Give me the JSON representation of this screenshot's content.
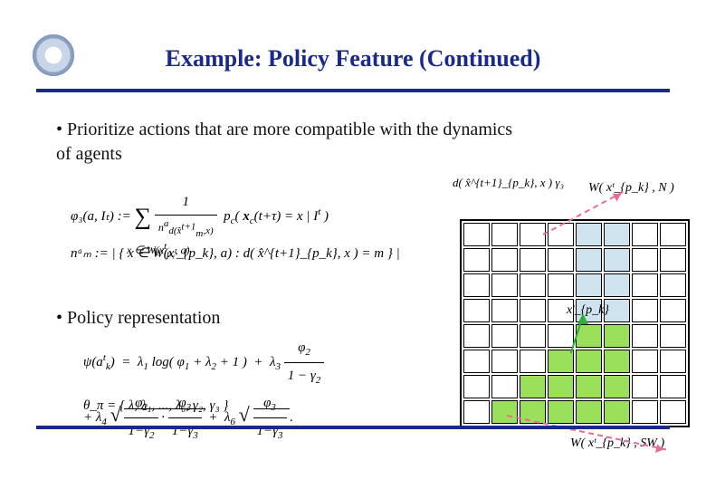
{
  "title": "Example: Policy Feature (Continued)",
  "bullets": {
    "b1": "Prioritize actions that are more compatible with the dynamics of agents",
    "b2": "Policy representation"
  },
  "eq": {
    "phi3": "φ₃(a, Iₜ)  :=",
    "phi3_body": "∑  (1 / nᵃ_{d(x̂ᵐ^{t+1}, x)})  p_c( x_c(t+τ) = x | I^t )",
    "nm": "nᵃₘ :=  | { x ∈ W(xᵗ_{p_k}, a)  :  d( x̂^{t+1}_{p_k}, x ) = m } |",
    "psi": "ψ(aᵗ_k)  =  λ₁ log( φ₁ + λ₂ + 1 )  +  λ₃  φ₂ / (1 − γ₂)",
    "psi2": "+ λ₄ √( φ₂/(1−γ₂) · φ₃/(1−γ₃) )  +  λ₆ √( φ₃/(1−γ₃) ) .",
    "theta": "θ_π  =  { λ, λ₁, ..., λ₆, γ₂, γ₃ }"
  },
  "labels": {
    "wN": "W( xᵗ_{p_k} , N )",
    "dgamma": "d( x̂^{t+1}_{p_k}, x ) γ₃",
    "xp": "xᵗ_{p_k}",
    "wSW": "W( xᵗ_{p_k} , SW )"
  },
  "grid": {
    "rows": 8,
    "cols": 8,
    "blue": [
      [
        0,
        4
      ],
      [
        0,
        5
      ],
      [
        1,
        4
      ],
      [
        1,
        5
      ],
      [
        2,
        4
      ],
      [
        2,
        5
      ],
      [
        3,
        4
      ],
      [
        3,
        5
      ]
    ],
    "green": [
      [
        4,
        4
      ],
      [
        4,
        5
      ],
      [
        5,
        3
      ],
      [
        5,
        4
      ],
      [
        5,
        5
      ],
      [
        6,
        2
      ],
      [
        6,
        3
      ],
      [
        6,
        4
      ],
      [
        6,
        5
      ],
      [
        7,
        1
      ],
      [
        7,
        2
      ],
      [
        7,
        3
      ],
      [
        7,
        4
      ],
      [
        7,
        5
      ]
    ]
  }
}
